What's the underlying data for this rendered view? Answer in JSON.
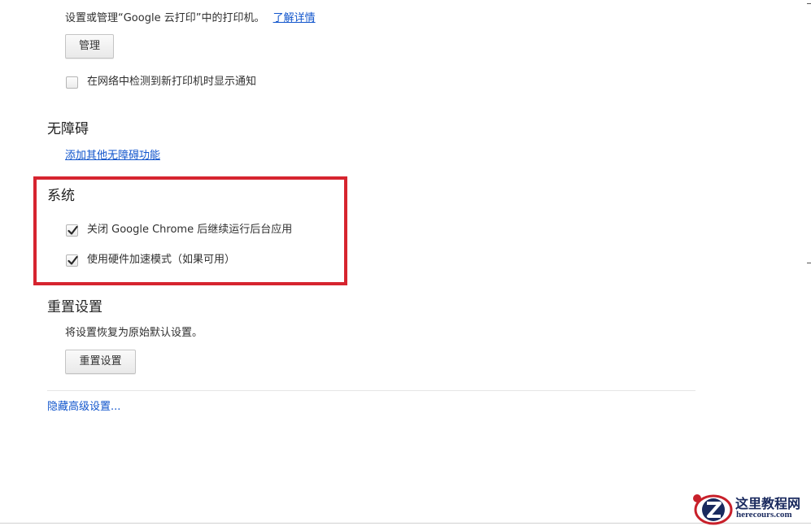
{
  "printers": {
    "description": "设置或管理“Google 云打印”中的打印机。",
    "learn_more_link": "了解详情",
    "manage_button": "管理",
    "notify_checkbox_label": "在网络中检测到新打印机时显示通知",
    "notify_checked": false
  },
  "accessibility": {
    "heading": "无障碍",
    "add_features_link": "添加其他无障碍功能"
  },
  "system": {
    "heading": "系统",
    "background_apps_label": "关闭 Google Chrome 后继续运行后台应用",
    "background_apps_checked": true,
    "hardware_accel_label": "使用硬件加速模式（如果可用）",
    "hardware_accel_checked": true,
    "highlight_color": "#d6242f"
  },
  "reset": {
    "heading": "重置设置",
    "description": "将设置恢复为原始默认设置。",
    "reset_button": "重置设置"
  },
  "hide_advanced_link": "隐藏高级设置...",
  "watermark": {
    "site_name": "这里教程网",
    "site_url": "herecours.com"
  },
  "colors": {
    "link": "#1155cc",
    "text": "#303030"
  }
}
